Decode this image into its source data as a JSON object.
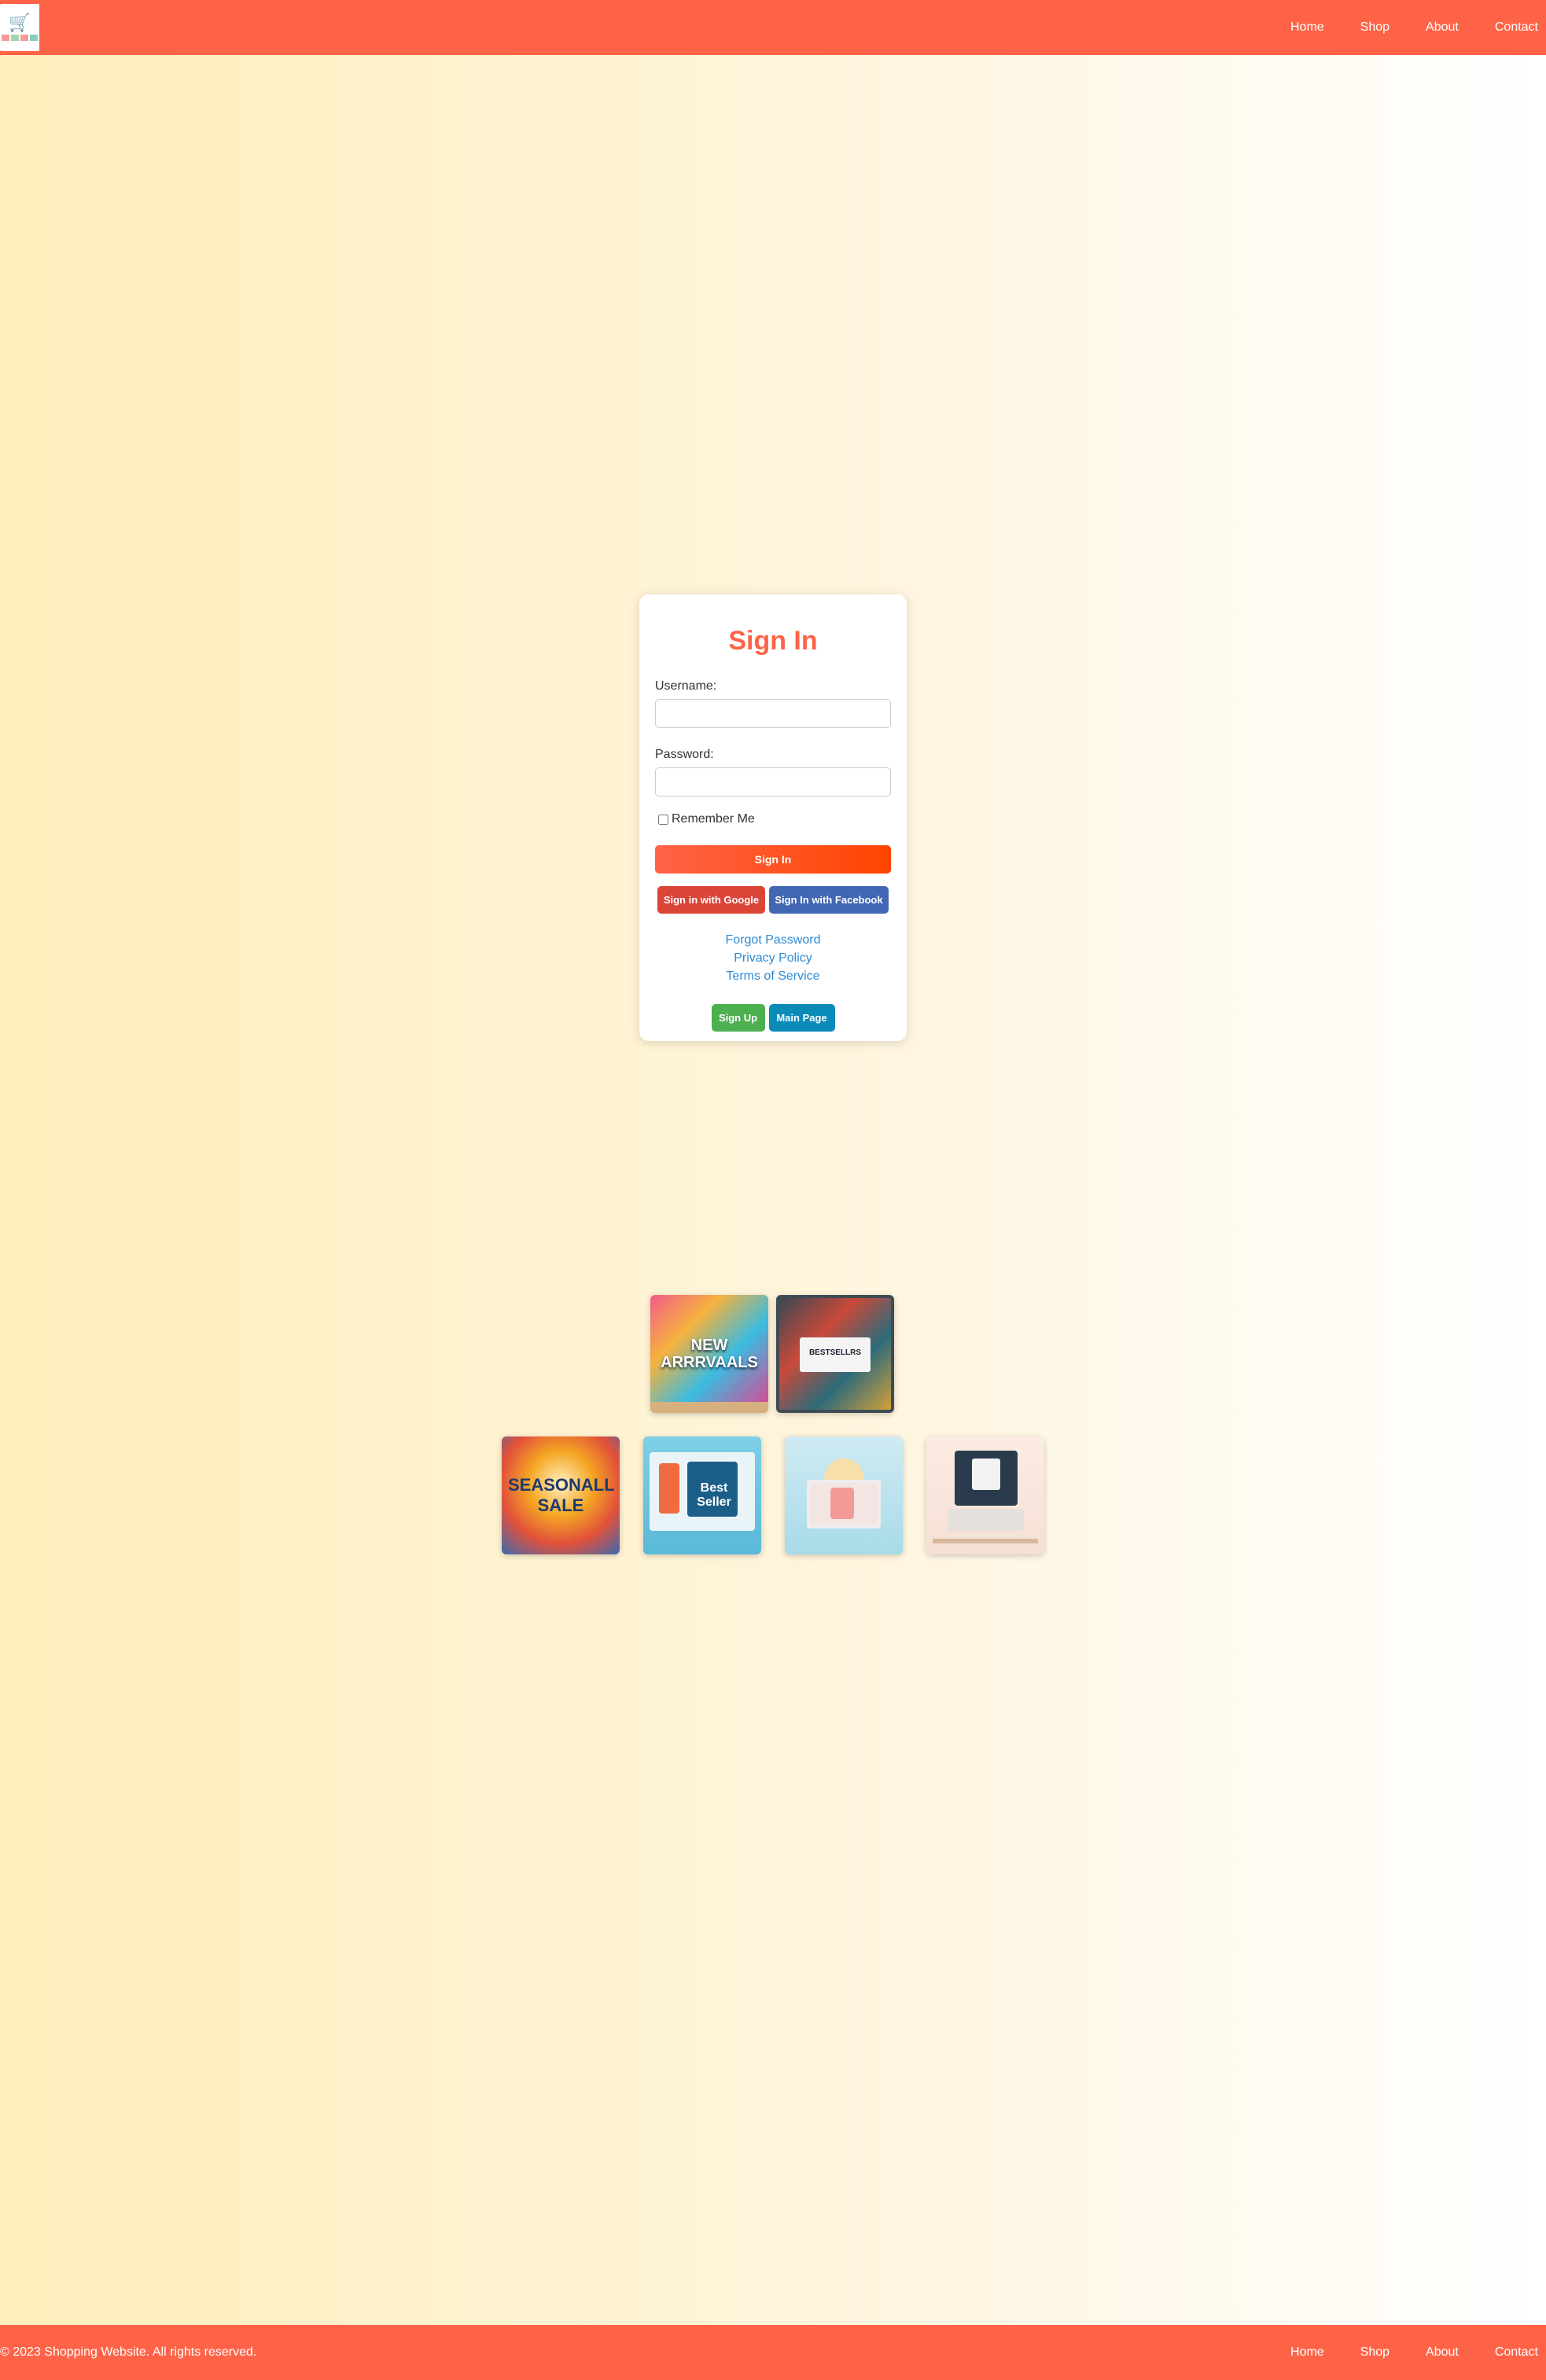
{
  "header": {
    "logo_icon": "shopping-cart-icon",
    "nav": [
      "Home",
      "Shop",
      "About",
      "Contact"
    ]
  },
  "signin": {
    "title": "Sign In",
    "username_label": "Username:",
    "password_label": "Password:",
    "remember_label": "Remember Me",
    "signin_button": "Sign In",
    "google_button": "Sign in with Google",
    "facebook_button": "Sign In with Facebook",
    "links": [
      "Forgot Password",
      "Privacy Policy",
      "Terms of Service"
    ],
    "signup_button": "Sign Up",
    "main_button": "Main Page"
  },
  "promos": {
    "row1": [
      "NEW ARRRVAALS",
      "BESTSELLRS"
    ],
    "row2": [
      "SEASONALL SALE",
      "Best Seller",
      "",
      ""
    ]
  },
  "footer": {
    "copyright": "© 2023 Shopping Website. All rights reserved.",
    "nav": [
      "Home",
      "Shop",
      "About",
      "Contact"
    ]
  },
  "colors": {
    "primary": "#ff6347",
    "google": "#db4437",
    "facebook": "#4267b2",
    "signup": "#4caf50",
    "main_page": "#0a8bb8",
    "link": "#2a8bd8"
  }
}
